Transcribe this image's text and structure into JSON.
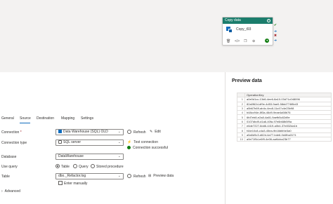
{
  "activity": {
    "header": "Copy data",
    "name": "Copy_t93",
    "info_icon": "info-icon",
    "side_icons": [
      "check-icon",
      "arrow-icon",
      "close-icon",
      "arrow-right-icon"
    ]
  },
  "tabs": [
    "General",
    "Source",
    "Destination",
    "Mapping",
    "Settings"
  ],
  "active_tab": "Source",
  "form": {
    "connection_label": "Connection",
    "connection_required": "*",
    "connection_value": "Data Warehouse (SQL) OLD",
    "refresh_label": "Refresh",
    "edit_label": "Edit",
    "connection_type_label": "Connection type",
    "connection_type_value": "SQL server",
    "test_connection_label": "Test connection",
    "connection_status": "Connection successful",
    "database_label": "Database",
    "database_value": "DataWarehouse",
    "use_query_label": "Use query",
    "use_query_options": [
      "Table",
      "Query",
      "Stored procedure"
    ],
    "table_label": "Table",
    "table_value": "dbo._Refactor.log",
    "table_refresh_label": "Refresh",
    "preview_data_label": "Preview data",
    "enter_manually_label": "Enter manually",
    "advanced_label": "Advanced"
  },
  "preview": {
    "title": "Preview data",
    "column": "OperationKey",
    "rows": [
      {
        "n": "1",
        "v": "a0e0d1cc-13d6-4ee6-8a10-03d71c048096"
      },
      {
        "n": "2",
        "v": "82a0f62d-df9e-4d53-9ae0-58dd774f8b43"
      },
      {
        "n": "3",
        "v": "a5b67b69-ab4c-4ec8-11c47c4e23b98"
      },
      {
        "n": "4",
        "v": "b48cc94e-8f3a-46d9-9eae4a58b76"
      },
      {
        "n": "5",
        "v": "6fd7eb8-e2a8-4a81-9aefb5c82d9e"
      },
      {
        "n": "6",
        "v": "0107dbd9-d1a6-40fa-97e6b68b5f9a"
      },
      {
        "n": "7",
        "v": "e6de7227-8dd6-4419-a0b4-37e832da1b"
      },
      {
        "n": "8",
        "v": "f44e10c8-c4a3-45ea-9b18d6f4e3a0"
      },
      {
        "n": "9",
        "v": "a5a5d9c3-d62d-4a77-bde6-0d4fba3171"
      },
      {
        "n": "10",
        "v": "a9e71f5d-e6f9-4e06-aaf4cba23b77"
      }
    ]
  },
  "colors": {
    "accent": "#0f6cbd",
    "activity_header": "#1b7d6c",
    "success": "#107c10",
    "required": "#a4262c"
  }
}
